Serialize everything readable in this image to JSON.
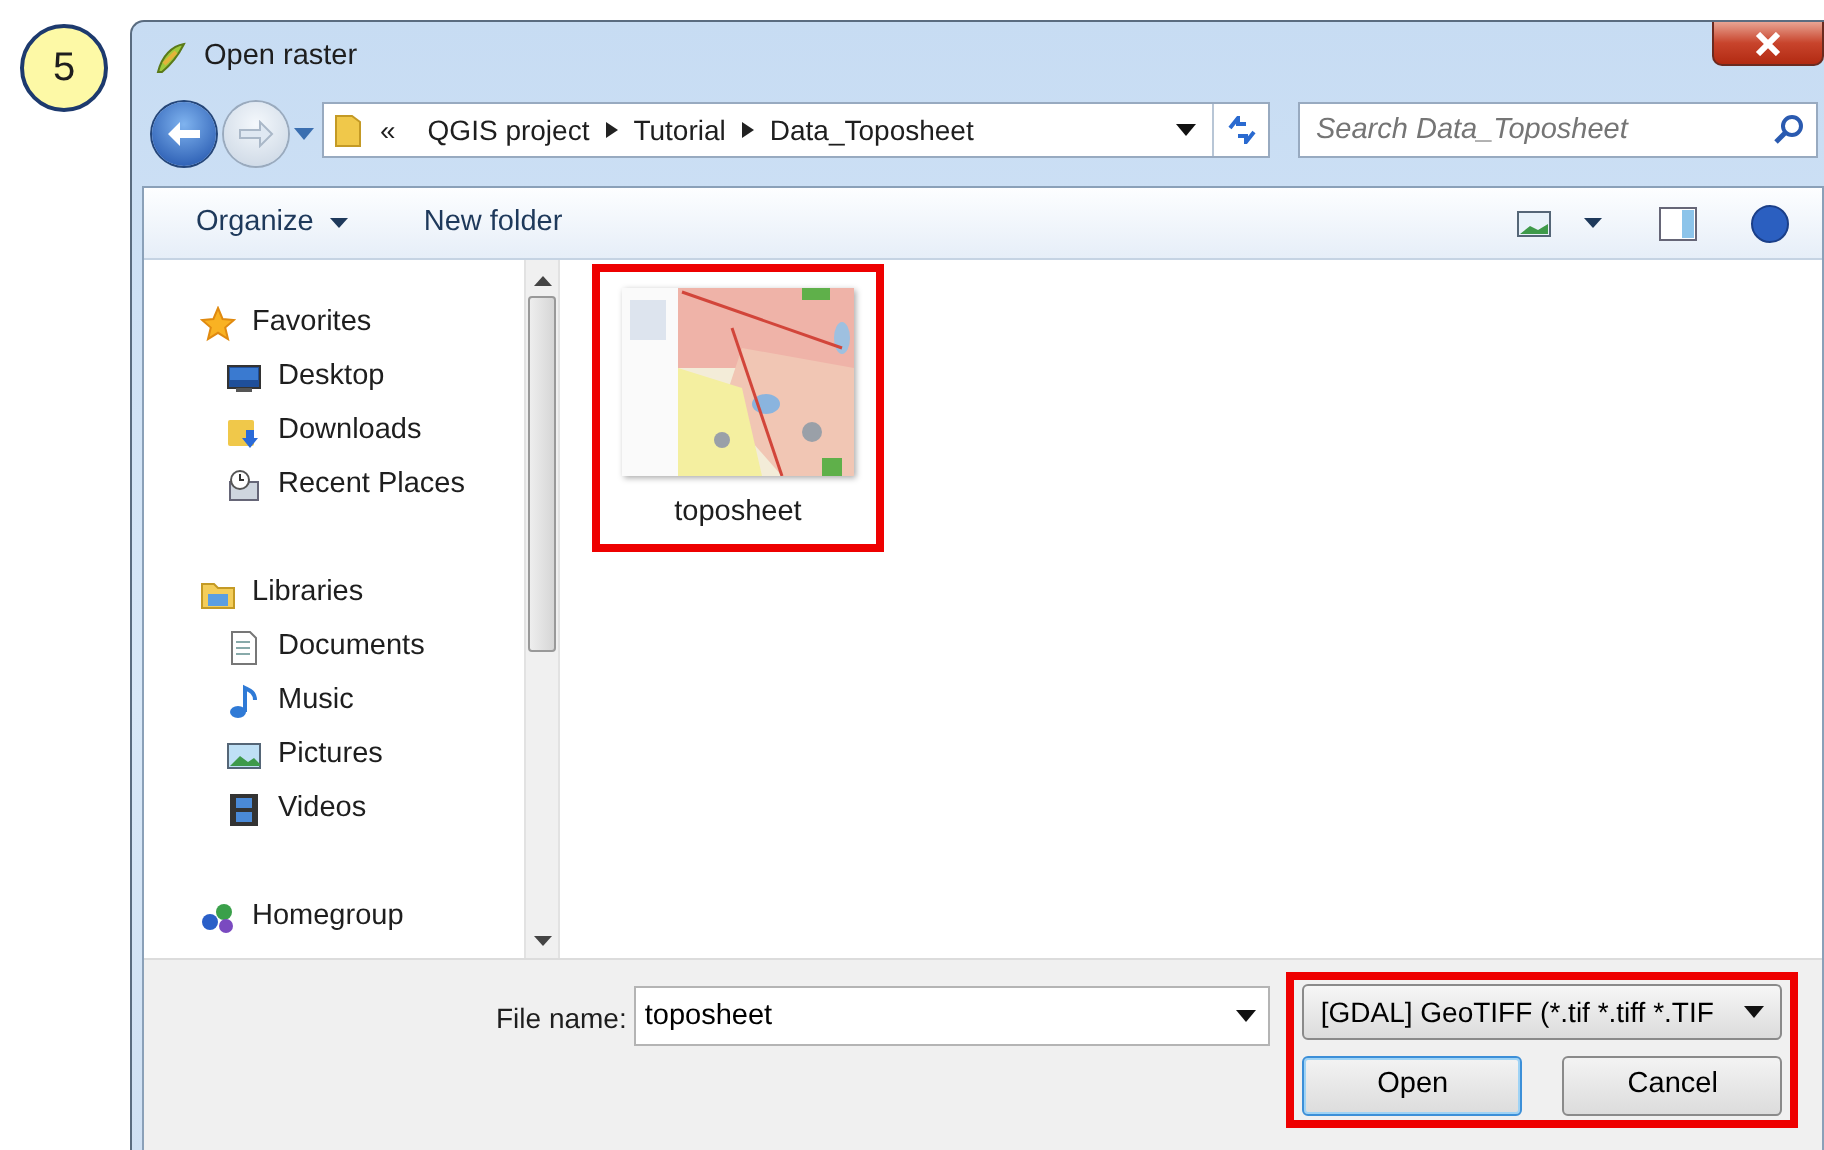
{
  "step_badge": "5",
  "window": {
    "title": "Open raster"
  },
  "address": {
    "overflow": "«",
    "crumbs": [
      "QGIS project",
      "Tutorial",
      "Data_Toposheet"
    ]
  },
  "search": {
    "placeholder": "Search Data_Toposheet"
  },
  "toolbar": {
    "organize": "Organize",
    "new_folder": "New folder"
  },
  "nav": [
    {
      "label": "Favorites",
      "kind": "star",
      "children": [
        {
          "label": "Desktop",
          "kind": "desktop"
        },
        {
          "label": "Downloads",
          "kind": "download"
        },
        {
          "label": "Recent Places",
          "kind": "recent"
        }
      ]
    },
    {
      "label": "Libraries",
      "kind": "library",
      "children": [
        {
          "label": "Documents",
          "kind": "document"
        },
        {
          "label": "Music",
          "kind": "music"
        },
        {
          "label": "Pictures",
          "kind": "pictures"
        },
        {
          "label": "Videos",
          "kind": "video"
        }
      ]
    },
    {
      "label": "Homegroup",
      "kind": "homegroup"
    }
  ],
  "files": [
    {
      "name": "toposheet",
      "highlighted": true
    }
  ],
  "file_name": {
    "label": "File name:",
    "value": "toposheet"
  },
  "actions": {
    "highlighted": true,
    "filter": "[GDAL] GeoTIFF (*.tif *.tiff *.TIF",
    "buttons": [
      {
        "label": "Open",
        "default": true
      },
      {
        "label": "Cancel",
        "default": false
      }
    ]
  }
}
